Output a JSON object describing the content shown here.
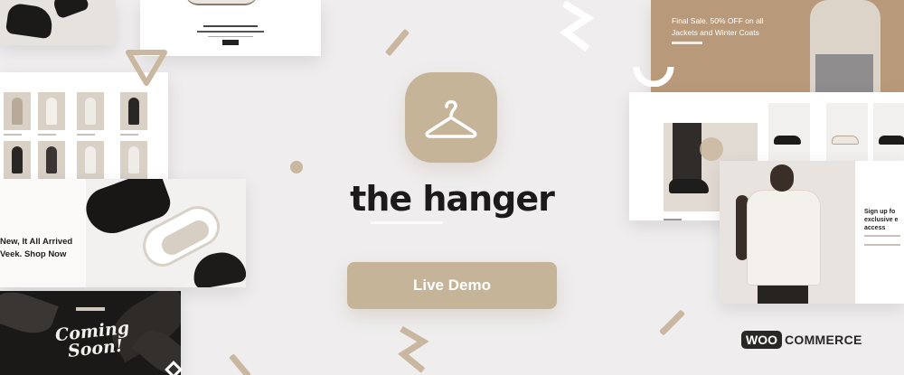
{
  "brand": {
    "name": "the hanger",
    "logo_icon": "hanger-icon",
    "accent_color": "#c6b498"
  },
  "cta": {
    "label": "Live Demo"
  },
  "mockups": {
    "sale_banner": {
      "text": "Final Sale. 50% OFF on all Jackets and Winter Coats"
    },
    "sneaker_banner": {
      "line1": "New, It All Arrived",
      "line2": "Veek. Shop Now"
    },
    "coming_soon": {
      "line1": "Coming",
      "line2": "Soon!"
    },
    "signup": {
      "line1": "Sign up fo",
      "line2": "exclusive e",
      "line3": "access"
    }
  },
  "badge": {
    "woo": "WOO",
    "commerce": "COMMERCE"
  }
}
